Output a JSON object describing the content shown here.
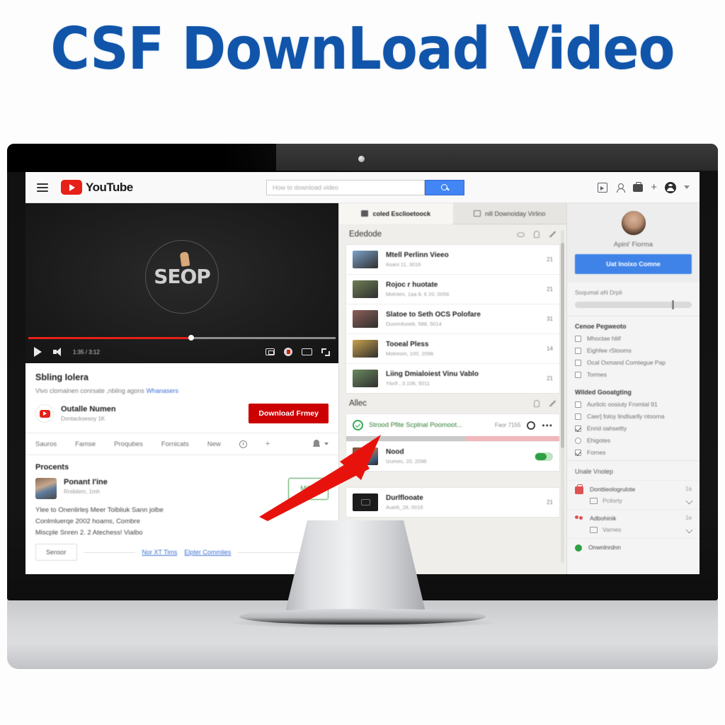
{
  "title": "CSF DownLoad Video",
  "header": {
    "menu_icon": "hamburger-menu-icon",
    "logo_text": "YouTube",
    "search_placeholder": "How to download video",
    "search_value": "",
    "search_button_icon": "search-icon",
    "icons": [
      "video-upload-icon",
      "person-icon",
      "apps-icon",
      "plus-icon",
      "account-avatar-icon",
      "chevron-down-icon"
    ]
  },
  "player": {
    "logo_text": "SEOP",
    "time_label": "1:35 / 3:12",
    "progress_percent": 53,
    "play_icon": "play-icon",
    "volume_icon": "volume-icon",
    "right_icons": [
      "miniplayer-icon",
      "settings-gear-icon",
      "captions-icon",
      "fullscreen-icon"
    ]
  },
  "video": {
    "heading": "Sbling Iolera",
    "description": "Vivo clomalnen conrsate ,nbling agons ",
    "description_link": "Whanasers",
    "channel_name": "Outalle Numen",
    "channel_subscribers": "Dontacksesoy 1K",
    "download_button": "Download Frmey",
    "tabs": [
      "Sauros",
      "Famse",
      "Proqubes",
      "Fornicats",
      "New"
    ],
    "tab_clock_icon": "clock-plus-icon",
    "tab_bell_icon": "bell-icon"
  },
  "comments": {
    "heading": "Procents",
    "author": "Ponant I'ine",
    "date": "Rniildem, 1mh",
    "ok_button": "MOK",
    "lines": [
      "Ylee to Onenlirleş Meer Tolbliuk Sann jolbe",
      "Conlmluerqe 2002 hoams, Combre",
      "Miscple Snren 2. 2 Atechess! Vialbo"
    ],
    "reply_button": "Sensor",
    "links": [
      "Nor XT Tims",
      "Elpter Commlies"
    ],
    "expand_icon": "chevron-down-icon"
  },
  "middle": {
    "tabs": [
      {
        "label": "coled Esclioetoock",
        "icon": "folder-icon",
        "active": true
      },
      {
        "label": "nill Downoiday Virlino",
        "icon": "video-icon",
        "active": false
      }
    ],
    "section_title": "Ededode",
    "section_icons": [
      "eye-icon",
      "bulb-icon",
      "pencil-icon"
    ],
    "items": [
      {
        "title": "Mtell Perlinn Vieeo",
        "date": "Asani 11, 3016",
        "num": "21",
        "thumb": "#7ba3c9"
      },
      {
        "title": "Rojoc r huotate",
        "date": "Molnten, 1aa 8, 6 20, 0056",
        "num": "21",
        "thumb": "#6f7f55"
      },
      {
        "title": "Slatoe to Seth OCS Polofare",
        "date": "Duonrduoeb, 588, 5014",
        "num": "31",
        "thumb": "#8d5f57"
      },
      {
        "title": "Tooeal Pless",
        "date": "Motreom, 100, 2096",
        "num": "14",
        "thumb": "#c9a24d"
      },
      {
        "title": "Liing Dmialoiest Vinu Vablo",
        "date": "Ylorll , 3.106, 5011",
        "num": "21",
        "thumb": "#6b8a5f"
      }
    ],
    "download_section": {
      "title": "Allec",
      "icons": [
        "filter-icon",
        "sort-icon"
      ],
      "active_name": "Strood Pfite Scplnal Poomoot...",
      "active_size": "Faor 7155",
      "gear_icon": "settings-gear-icon",
      "menu_icon": "more-options-icon",
      "progress_percent": 56,
      "status_icon": "check-circle-icon",
      "row_title": "Nood",
      "row_date": "Izumes, 20, 2096",
      "toggle_on": true
    },
    "bottom_item": {
      "title": "Durlflooate",
      "date": "Auei6_28, 0016",
      "num": "21"
    }
  },
  "sidebar": {
    "profile_name": "Apini' Fiorma",
    "profile_button": "Uat lnoixo Comne",
    "slider_label": "Soqumal aN Drpli",
    "slider_percent": 84,
    "group1": {
      "heading": "Cenoe Pegweoto",
      "options": [
        {
          "label": "Mhoctae hliif",
          "checked": false
        },
        {
          "label": "Eighfee rStooms",
          "checked": false
        },
        {
          "label": "Ocal Oxmand Comtegue Pap",
          "checked": false
        },
        {
          "label": "Tormes",
          "checked": false
        }
      ]
    },
    "group2": {
      "heading": "Wilded Gooatgting",
      "options": [
        {
          "label": "Aurliclc oosiuty Fromtal 91",
          "checked": false
        },
        {
          "label": "Caer] foloy lindlsarlly ntoorna",
          "checked": false
        },
        {
          "label": "Enrid oahsetlty",
          "checked": true
        },
        {
          "label": "Ehigotes",
          "checked": false,
          "round": true
        },
        {
          "label": "Fornes",
          "checked": true
        }
      ]
    },
    "bottom_heading": "Unale Vnolep",
    "bottom_items": [
      {
        "icon": "red-bag-icon",
        "title": "Donttieologrulote",
        "sub_icon": "folder-icon",
        "sub": "Pcilorty",
        "count": "1a"
      },
      {
        "icon": "red-people-icon",
        "title": "Adbohinik",
        "sub_icon": "card-icon",
        "sub": "Varnes",
        "count": "1e"
      },
      {
        "icon": "green-dot-icon",
        "title": "Onwnlnrdnn",
        "sub_icon": "",
        "sub": "",
        "count": ""
      }
    ]
  }
}
